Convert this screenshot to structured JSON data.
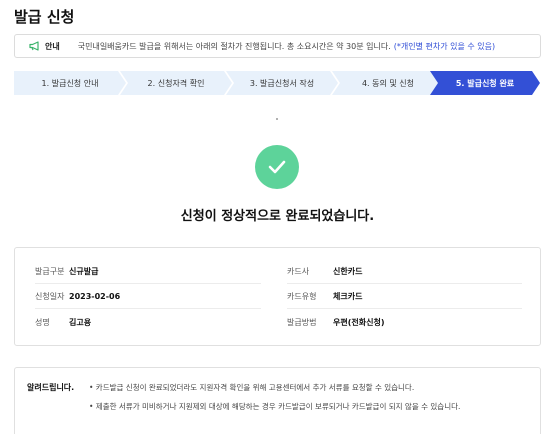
{
  "page": {
    "title": "발급 신청"
  },
  "notice": {
    "icon": "megaphone-icon",
    "label": "안내",
    "text": "국민내일배움카드 발급을 위해서는 아래의 절차가 진행됩니다. 총 소요시간은 약 30분 입니다.",
    "highlight": "(*개인별 편차가 있을 수 있음)",
    "highlight_color": "#2f4dd6",
    "icon_color": "#3bb36b"
  },
  "steps": [
    {
      "label": "1. 발급신청 안내",
      "active": false
    },
    {
      "label": "2. 신청자격 확인",
      "active": false
    },
    {
      "label": "3. 발급신청서 작성",
      "active": false
    },
    {
      "label": "4. 동의 및 신청",
      "active": false
    },
    {
      "label": "5. 발급신청 완료",
      "active": true
    }
  ],
  "step_colors": {
    "inactive": "#e8f1fb",
    "active": "#3350d6"
  },
  "result": {
    "icon": "check-circle-icon",
    "icon_color": "#5dd39a",
    "message": "신청이 정상적으로 완료되었습니다."
  },
  "details": {
    "left": [
      {
        "label": "발급구분",
        "value": "신규발급"
      },
      {
        "label": "신청일자",
        "value": "2023-02-06"
      },
      {
        "label": "성명",
        "value": "김고용"
      }
    ],
    "right": [
      {
        "label": "카드사",
        "value": "신한카드"
      },
      {
        "label": "카드유형",
        "value": "체크카드"
      },
      {
        "label": "발급방법",
        "value": "우편(전화신청)"
      }
    ]
  },
  "alert": {
    "title": "알려드립니다.",
    "items": [
      "• 카드발급 신청이 완료되었더라도 지원자격 확인을 위해 고용센터에서 추가 서류를 요청할 수 있습니다.",
      "• 제출한 서류가 미비하거나 지원제외 대상에 해당하는 경우 카드발급이 보류되거나 카드발급이 되지 않을 수 있습니다."
    ]
  }
}
